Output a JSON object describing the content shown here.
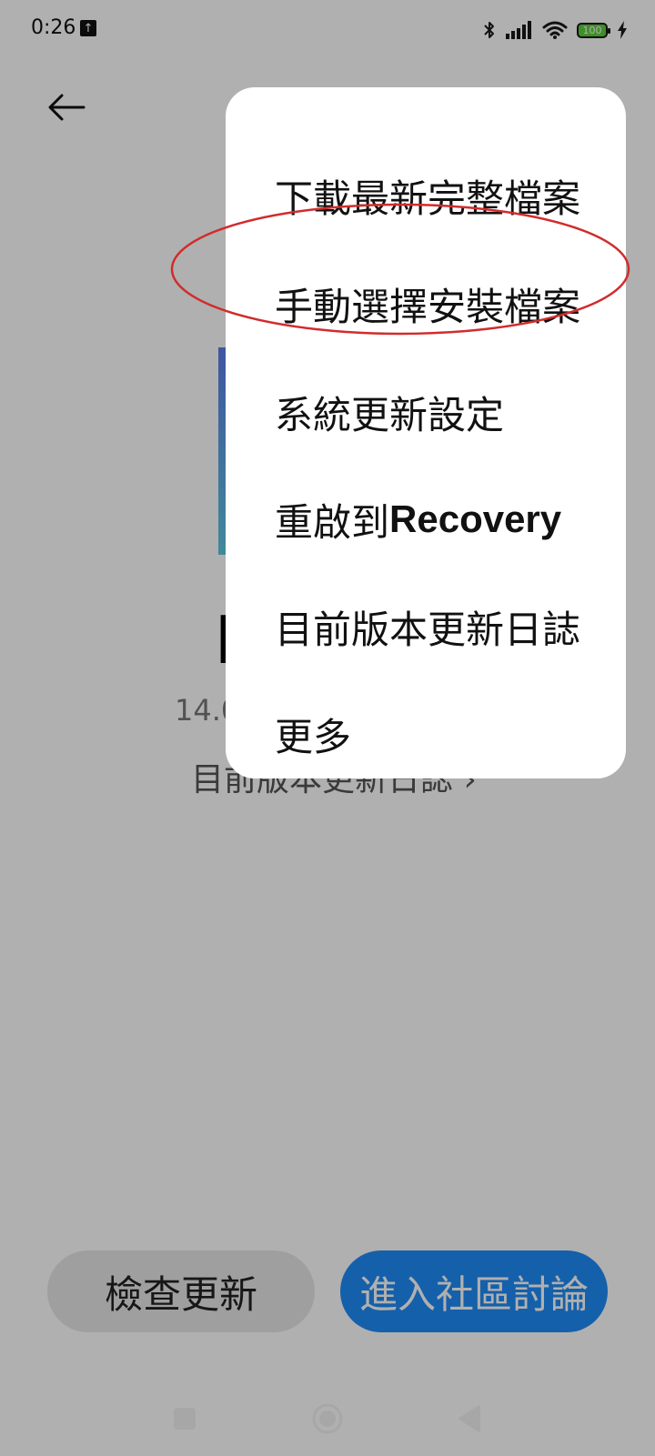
{
  "status_bar": {
    "time": "0:26",
    "battery": "100"
  },
  "page": {
    "device_name": "M",
    "version": "14.0",
    "changelog": "目前版本更新日誌 ›",
    "check_update_label": "檢查更新",
    "community_label": "進入社區討論"
  },
  "menu": {
    "items": [
      {
        "label": "下載最新完整檔案"
      },
      {
        "label": "手動選擇安裝檔案"
      },
      {
        "label": "系統更新設定"
      },
      {
        "label": "重啟到Recovery",
        "prefix": "重啟到",
        "suffix": "Recovery"
      },
      {
        "label": "目前版本更新日誌"
      },
      {
        "label": "更多"
      }
    ]
  },
  "colors": {
    "accent": "#1f8cf7",
    "annotation": "#d12c2c",
    "battery": "#5bcf3a"
  },
  "icons": {
    "back": "back-arrow-icon",
    "upload": "upload-icon",
    "bluetooth": "bluetooth-icon",
    "signal": "signal-icon",
    "wifi": "wifi-icon",
    "charging": "charging-bolt-icon"
  }
}
